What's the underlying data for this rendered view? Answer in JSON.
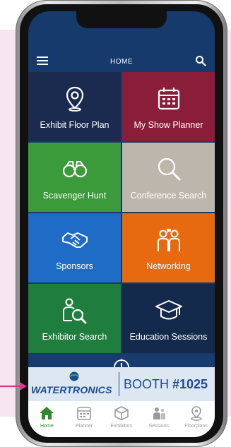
{
  "header": {
    "title": "HOME"
  },
  "tiles": [
    {
      "label": "Exhibit Floor Plan",
      "icon": "map-pin-icon"
    },
    {
      "label": "My Show Planner",
      "icon": "calendar-icon"
    },
    {
      "label": "Scavenger Hunt",
      "icon": "binoculars-icon"
    },
    {
      "label": "Conference Search",
      "icon": "search-icon"
    },
    {
      "label": "Sponsors",
      "icon": "handshake-icon"
    },
    {
      "label": "Networking",
      "icon": "people-icon"
    },
    {
      "label": "Exhibitor Search",
      "icon": "person-search-icon"
    },
    {
      "label": "Education Sessions",
      "icon": "graduation-cap-icon"
    }
  ],
  "ad": {
    "brand": "WATERTRONICS",
    "booth_text": "BOOTH ",
    "booth_number": "#1025"
  },
  "tabs": [
    {
      "label": "Home",
      "icon": "home-icon"
    },
    {
      "label": "Planner",
      "icon": "calendar-icon"
    },
    {
      "label": "Exhibitors",
      "icon": "cube-icon"
    },
    {
      "label": "Sessions",
      "icon": "people-icon"
    },
    {
      "label": "Floorplans",
      "icon": "map-pin-icon"
    }
  ],
  "colors": {
    "accent": "#153a6b",
    "tile_maroon": "#8a1d3a",
    "tile_green": "#3b9a3a",
    "tile_blue": "#1f6cc6",
    "tile_orange": "#e86a10",
    "pink_accent": "#e0338e"
  }
}
